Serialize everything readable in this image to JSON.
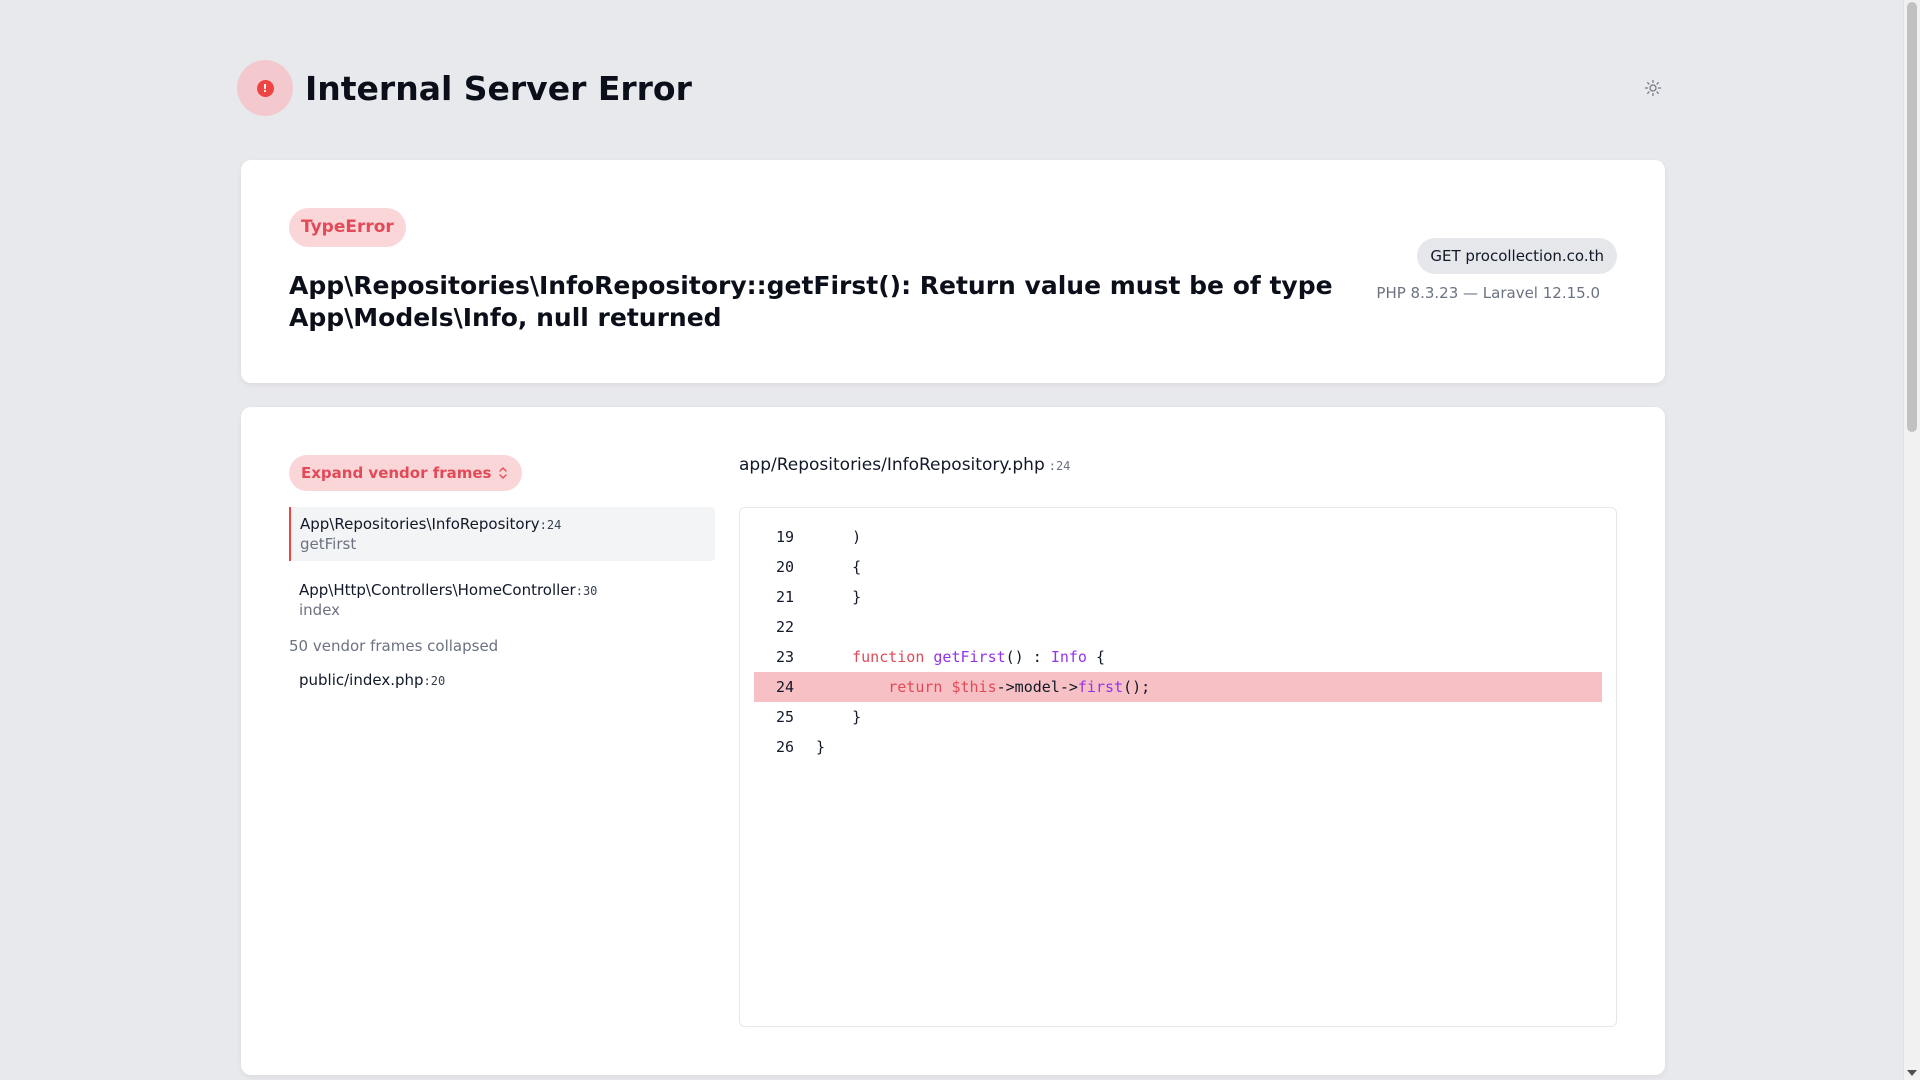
{
  "header": {
    "title": "Internal Server Error",
    "error_glyph": "!"
  },
  "error": {
    "type": "TypeError",
    "message": "App\\Repositories\\InfoRepository::getFirst(): Return value must be of type App\\Models\\Info, null returned",
    "request": "GET procollection.co.th",
    "versions": "PHP 8.3.23 — Laravel 12.15.0"
  },
  "trace": {
    "expand_label": "Expand vendor frames",
    "frames": [
      {
        "class": "App\\Repositories\\InfoRepository",
        "line": ":24",
        "method": "getFirst",
        "active": true
      },
      {
        "class": "App\\Http\\Controllers\\HomeController",
        "line": ":30",
        "method": "index",
        "active": false
      }
    ],
    "collapsed_note": "50 vendor frames collapsed",
    "last_frame": {
      "class": "public/index.php",
      "line": ":20"
    }
  },
  "code": {
    "file": "app/Repositories/InfoRepository.php",
    "line": ":24",
    "highlight_line": 24,
    "lines": [
      {
        "num": "19",
        "text": "    )"
      },
      {
        "num": "20",
        "text": "    {"
      },
      {
        "num": "21",
        "text": "    }"
      },
      {
        "num": "22",
        "text": ""
      },
      {
        "num": "23",
        "text": "    function getFirst() : Info {"
      },
      {
        "num": "24",
        "text": "        return $this->model->first();"
      },
      {
        "num": "25",
        "text": "    }"
      },
      {
        "num": "26",
        "text": "}"
      }
    ]
  },
  "colors": {
    "accent": "#e24a58",
    "badge_bg": "#fbd6d9",
    "highlight": "#f7c0c4",
    "background": "#e8e9ed"
  },
  "icons": [
    "error-icon",
    "sun-icon",
    "chevron-up-down-icon"
  ]
}
